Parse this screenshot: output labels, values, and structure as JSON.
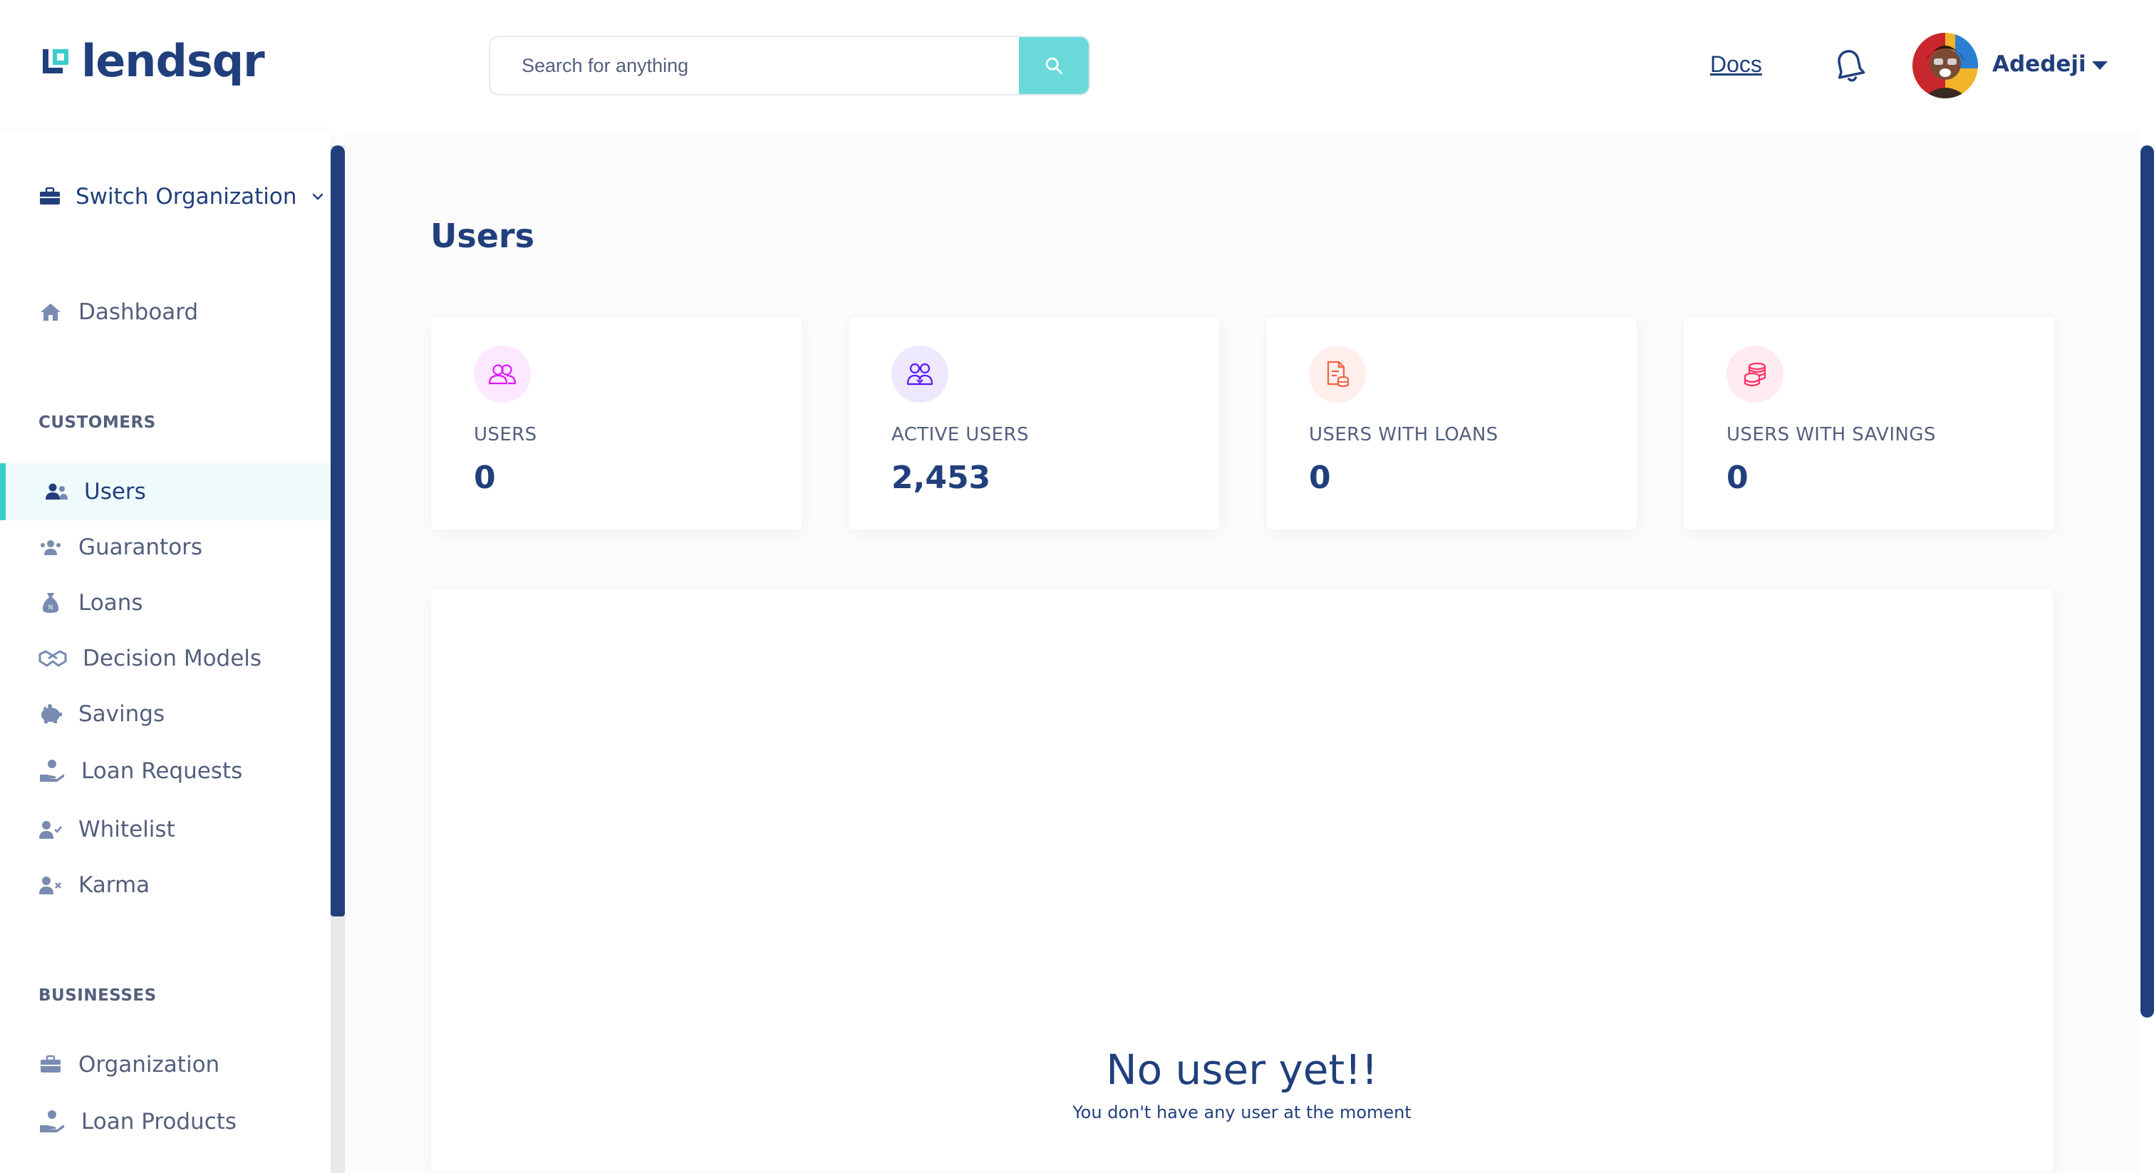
{
  "brand": {
    "name": "lendsqr",
    "accent": "#39CDCC",
    "primary": "#213F7D",
    "text_secondary": "#545F7D"
  },
  "header": {
    "search": {
      "placeholder": "Search for anything",
      "icon": "search-icon"
    },
    "docs_label": "Docs",
    "notification_icon": "bell-icon",
    "user": {
      "name": "Adedeji",
      "avatar": "user-avatar-photo"
    }
  },
  "sidebar": {
    "switch_org": {
      "label": "Switch Organization",
      "icon": "briefcase-icon"
    },
    "dashboard": {
      "label": "Dashboard",
      "icon": "home-icon"
    },
    "sections": [
      {
        "title": "CUSTOMERS",
        "items": [
          {
            "label": "Users",
            "icon": "users-icon",
            "active": true
          },
          {
            "label": "Guarantors",
            "icon": "guarantors-icon"
          },
          {
            "label": "Loans",
            "icon": "money-sack-icon"
          },
          {
            "label": "Decision Models",
            "icon": "handshake-icon"
          },
          {
            "label": "Savings",
            "icon": "piggy-bank-icon"
          },
          {
            "label": "Loan Requests",
            "icon": "hand-coin-icon"
          },
          {
            "label": "Whitelist",
            "icon": "user-check-icon"
          },
          {
            "label": "Karma",
            "icon": "user-x-icon"
          }
        ]
      },
      {
        "title": "BUSINESSES",
        "items": [
          {
            "label": "Organization",
            "icon": "briefcase-icon"
          },
          {
            "label": "Loan Products",
            "icon": "hand-coin-icon"
          }
        ]
      }
    ]
  },
  "main": {
    "title": "Users",
    "stats": [
      {
        "label": "USERS",
        "value": "0",
        "icon": "users-icon",
        "icon_color": "#DF18FF",
        "icon_bg": "#FCE8FF"
      },
      {
        "label": "ACTIVE USERS",
        "value": "2,453",
        "icon": "active-users-icon",
        "icon_color": "#5718FF",
        "icon_bg": "#EEE8FF"
      },
      {
        "label": "USERS WITH LOANS",
        "value": "0",
        "icon": "loan-document-icon",
        "icon_color": "#F55F44",
        "icon_bg": "#FEEFEC"
      },
      {
        "label": "USERS WITH SAVINGS",
        "value": "0",
        "icon": "coins-stack-icon",
        "icon_color": "#FF3366",
        "icon_bg": "#FFEBF0"
      }
    ],
    "empty_state": {
      "title": "No user yet!!",
      "subtitle": "You don't have any user at the moment"
    }
  }
}
